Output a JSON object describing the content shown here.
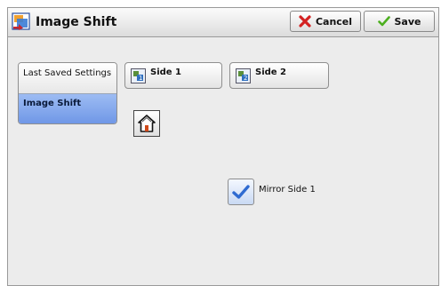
{
  "header": {
    "title": "Image Shift",
    "cancel_label": "Cancel",
    "save_label": "Save",
    "title_icon": "image-shift-icon",
    "cancel_icon": "red-x-icon",
    "save_icon": "check-icon"
  },
  "sidebar": {
    "items": [
      {
        "label": "Last Saved Settings",
        "selected": false
      },
      {
        "label": "Image Shift",
        "selected": true
      }
    ]
  },
  "sides": {
    "side1_label": "Side 1",
    "side2_label": "Side 2"
  },
  "options": {
    "home_icon": "home-icon",
    "mirror_label": "Mirror Side 1",
    "mirror_checked": true
  },
  "colors": {
    "selected": "#6d95e6",
    "cancel_red": "#d32121",
    "save_green": "#4caf1f"
  }
}
